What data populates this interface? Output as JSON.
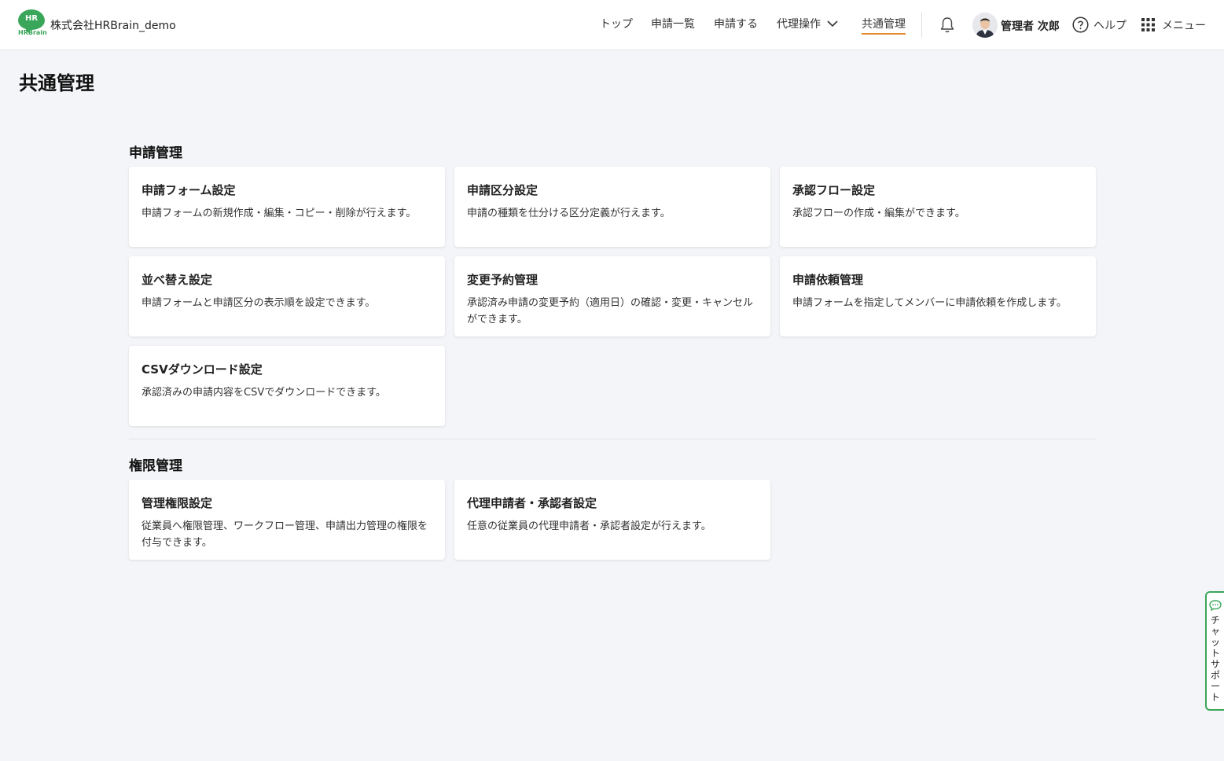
{
  "header": {
    "logo_text": "HR",
    "logo_sub": "HRBrain",
    "company": "株式会社HRBrain_demo",
    "nav": [
      {
        "label": "トップ"
      },
      {
        "label": "申請一覧"
      },
      {
        "label": "申請する"
      },
      {
        "label": "代理操作"
      },
      {
        "label": "共通管理"
      }
    ],
    "user_name": "管理者 次郎",
    "help_label": "ヘルプ",
    "menu_label": "メニュー"
  },
  "page_title": "共通管理",
  "sections": [
    {
      "title": "申請管理",
      "cards": [
        {
          "title": "申請フォーム設定",
          "desc": "申請フォームの新規作成・編集・コピー・削除が行えます。"
        },
        {
          "title": "申請区分設定",
          "desc": "申請の種類を仕分ける区分定義が行えます。"
        },
        {
          "title": "承認フロー設定",
          "desc": "承認フローの作成・編集ができます。"
        },
        {
          "title": "並べ替え設定",
          "desc": "申請フォームと申請区分の表示順を設定できます。"
        },
        {
          "title": "変更予約管理",
          "desc": "承認済み申請の変更予約（適用日）の確認・変更・キャンセルができます。"
        },
        {
          "title": "申請依頼管理",
          "desc": "申請フォームを指定してメンバーに申請依頼を作成します。"
        },
        {
          "title": "CSVダウンロード設定",
          "desc": "承認済みの申請内容をCSVでダウンロードできます。"
        }
      ]
    },
    {
      "title": "権限管理",
      "cards": [
        {
          "title": "管理権限設定",
          "desc": "従業員へ権限管理、ワークフロー管理、申請出力管理の権限を付与できます。"
        },
        {
          "title": "代理申請者・承認者設定",
          "desc": "任意の従業員の代理申請者・承認者設定が行えます。"
        }
      ]
    }
  ],
  "chat_support": "チャットサポート",
  "colors": {
    "brand": "#3aa65a",
    "active_underline": "#e08a2c"
  }
}
